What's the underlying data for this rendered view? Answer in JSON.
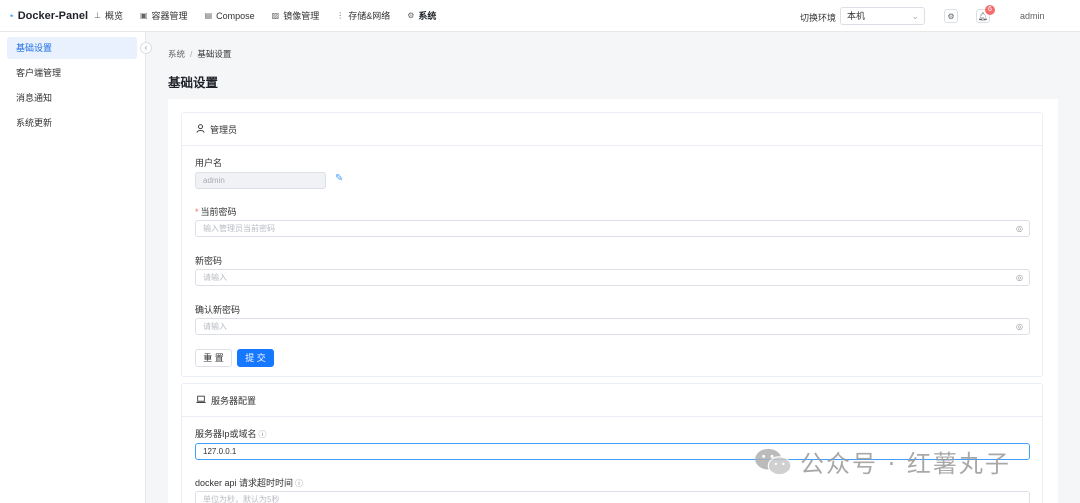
{
  "brand": {
    "name": "Docker-Panel"
  },
  "nav": [
    {
      "icon": "⊥",
      "label": "概览",
      "active": false
    },
    {
      "icon": "▣",
      "label": "容器管理",
      "active": false
    },
    {
      "icon": "▤",
      "label": "Compose",
      "active": false
    },
    {
      "icon": "▨",
      "label": "镜像管理",
      "active": false
    },
    {
      "icon": "⋮",
      "label": "存储&网络",
      "active": false
    },
    {
      "icon": "⚙",
      "label": "系统",
      "active": true
    }
  ],
  "header": {
    "env_label": "切换环境",
    "env_value": "本机",
    "notification_count": "6",
    "user": "admin"
  },
  "sidebar": {
    "items": [
      {
        "label": "基础设置",
        "active": true
      },
      {
        "label": "客户端管理",
        "active": false
      },
      {
        "label": "消息通知",
        "active": false
      },
      {
        "label": "系统更新",
        "active": false
      }
    ]
  },
  "breadcrumb": {
    "parent": "系统",
    "separator": "/",
    "current": "基础设置"
  },
  "page_title": "基础设置",
  "admin_card": {
    "title": "管理员",
    "username_label": "用户名",
    "username_value": "admin",
    "current_password_label": "当前密码",
    "current_password_placeholder": "输入管理员当前密码",
    "new_password_label": "新密码",
    "new_password_placeholder": "请输入",
    "confirm_password_label": "确认新密码",
    "confirm_password_placeholder": "请输入",
    "reset_button": "重 置",
    "submit_button": "提 交"
  },
  "server_card": {
    "title": "服务器配置",
    "host_label": "服务器Ip或域名",
    "host_value": "127.0.0.1",
    "timeout_label": "docker api 请求超时时间",
    "timeout_placeholder": "单位为秒，默认为5秒"
  },
  "watermark": {
    "text": "公众号 · 红薯丸子"
  },
  "colors": {
    "primary": "#1677ff",
    "active_bg": "#e8f1fd",
    "danger": "#f56c6c"
  }
}
